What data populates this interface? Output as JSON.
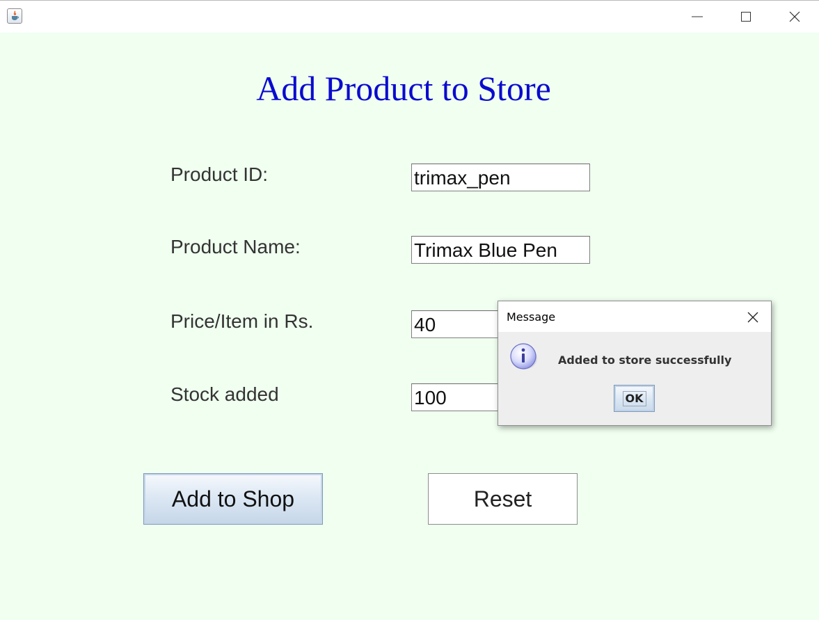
{
  "window": {
    "controls": {
      "minimize": "minimize",
      "maximize": "maximize",
      "close": "close"
    }
  },
  "form": {
    "title": "Add Product to Store",
    "fields": [
      {
        "label": "Product ID:",
        "value": "trimax_pen"
      },
      {
        "label": "Product Name:",
        "value": "Trimax Blue Pen"
      },
      {
        "label": "Price/Item in Rs.",
        "value": "40"
      },
      {
        "label": "Stock added",
        "value": "100"
      }
    ],
    "buttons": {
      "add": "Add to Shop",
      "reset": "Reset"
    }
  },
  "dialog": {
    "title": "Message",
    "message": "Added to store successfully",
    "ok": "OK",
    "icon": "info-icon"
  },
  "colors": {
    "background": "#f0fff0",
    "title": "#0a0acf"
  }
}
